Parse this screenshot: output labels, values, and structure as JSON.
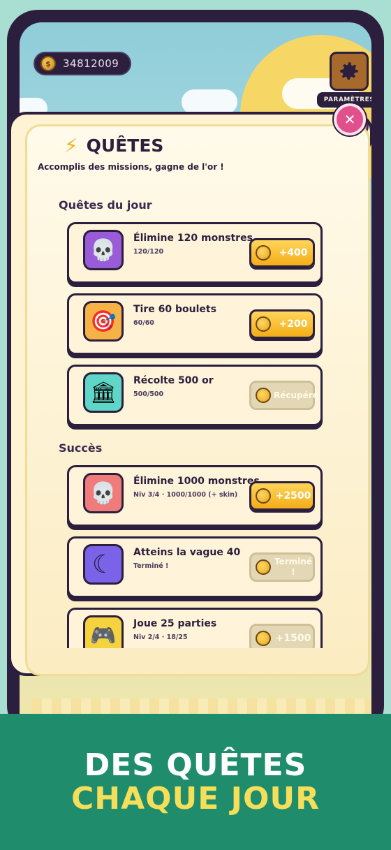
{
  "header": {
    "coins": "34812009",
    "coin_symbol": "$",
    "settings_label": "PARAMÈTRES"
  },
  "panel": {
    "title_icon": "⚡",
    "title": "QUÊTES",
    "subtitle": "Accomplis des missions, gagne de l'or !",
    "close_symbol": "✕"
  },
  "daily": {
    "heading": "Quêtes du jour",
    "items": [
      {
        "icon": "skull-icon",
        "glyph": "💀",
        "color": "#9a5bd8",
        "title": "Élimine 120 monstres",
        "progress": "120/120",
        "reward": "+400",
        "state": "claimable"
      },
      {
        "icon": "target-icon",
        "glyph": "🎯",
        "color": "#f5b347",
        "title": "Tire 60 boulets",
        "progress": "60/60",
        "reward": "+200",
        "state": "claimable"
      },
      {
        "icon": "bank-icon",
        "glyph": "🏛",
        "color": "#5fd6c8",
        "title": "Récolte 500 or",
        "progress": "500/500",
        "reward": "Récupéré",
        "state": "claimed"
      }
    ]
  },
  "achievements": {
    "heading": "Succès",
    "items": [
      {
        "icon": "skull-icon",
        "glyph": "💀",
        "color": "#f07b7b",
        "title": "Élimine 1000 monstres",
        "progress": "Niv 3/4 · 1000/1000 (+ skin)",
        "reward": "+2500",
        "state": "claimable"
      },
      {
        "icon": "moon-icon",
        "glyph": "☾",
        "color": "#7a63e8",
        "title": "Atteins la vague 40",
        "progress": "Terminé !",
        "reward": "Terminé !",
        "state": "done"
      },
      {
        "icon": "gamepad-icon",
        "glyph": "🎮",
        "color": "#f4d33f",
        "title": "Joue 25 parties",
        "progress": "Niv 2/4 · 18/25",
        "reward": "+1500",
        "state": "locked"
      }
    ]
  },
  "banner": {
    "line1": "DES QUÊTES",
    "line2": "CHAQUE JOUR"
  },
  "colors": {
    "dark": "#2b1f3d",
    "gold": "#f3ad18",
    "banner": "#1f8c6b",
    "banner_accent": "#f5df5a"
  }
}
